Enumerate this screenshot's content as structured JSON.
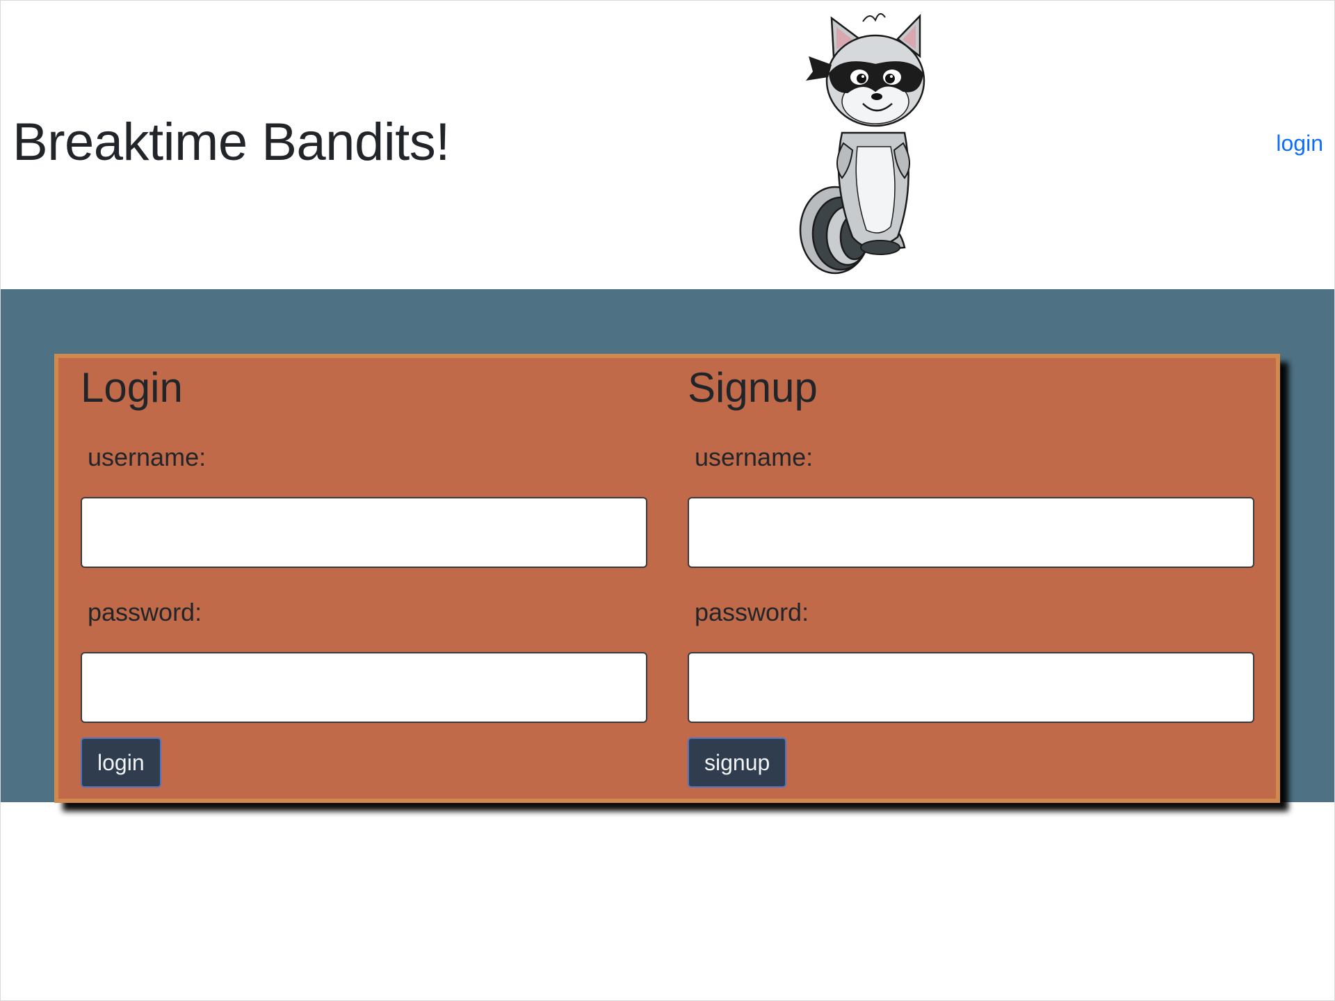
{
  "header": {
    "site_title": "Breaktime Bandits!",
    "mascot_icon": "raccoon-mascot-icon",
    "nav_login_label": "login"
  },
  "login_form": {
    "heading": "Login",
    "username_label": "username:",
    "username_value": "",
    "password_label": "password:",
    "password_value": "",
    "submit_label": "login"
  },
  "signup_form": {
    "heading": "Signup",
    "username_label": "username:",
    "username_value": "",
    "password_label": "password:",
    "password_value": "",
    "submit_label": "signup"
  },
  "colors": {
    "band_background": "#4e7184",
    "card_background": "#c06a49",
    "card_border": "#d08a4e",
    "button_background": "#2f3d4f",
    "link_color": "#0d6efd"
  }
}
